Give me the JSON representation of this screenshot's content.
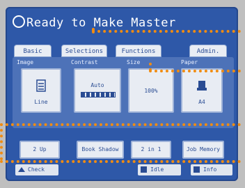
{
  "status": {
    "text": "Ready to Make Master"
  },
  "tabs": [
    {
      "label": "Basic"
    },
    {
      "label": "Selections"
    },
    {
      "label": "Functions"
    },
    {
      "label": "Admin."
    }
  ],
  "groups": {
    "image": {
      "label": "Image",
      "button": "Line"
    },
    "contrast": {
      "label": "Contrast",
      "button": "Auto"
    },
    "size": {
      "label": "Size",
      "button": "100%"
    },
    "paper": {
      "label": "Paper",
      "button": "A4"
    }
  },
  "row": [
    {
      "label": "2 Up"
    },
    {
      "label": "Book Shadow"
    },
    {
      "label": "2 in 1"
    },
    {
      "label": "Job Memory"
    }
  ],
  "bottom": {
    "left": "Check",
    "mid": "Idle",
    "right": "Info"
  },
  "colors": {
    "screen": "#2e58a8",
    "panel": "#4d72b8",
    "callout": "#f08c12"
  }
}
